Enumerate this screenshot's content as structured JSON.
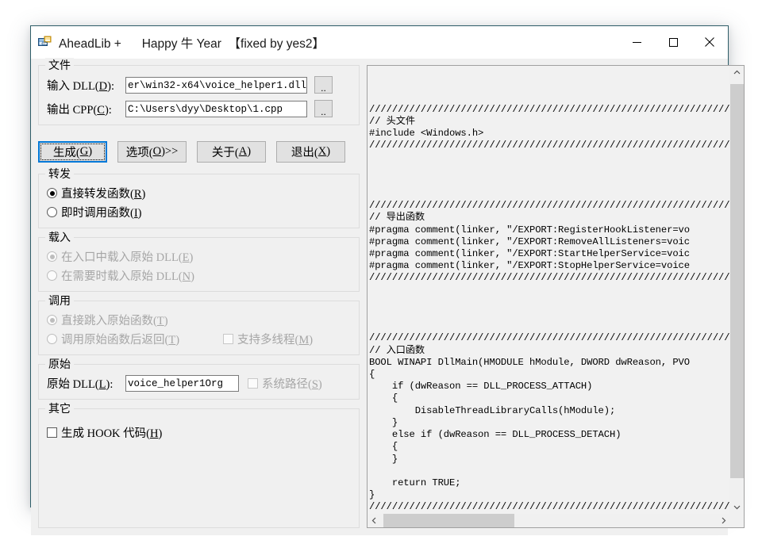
{
  "window": {
    "icon": "aheadlib-app-icon",
    "title": "AheadLib +      Happy 牛 Year  【fixed by yes2】",
    "controls": {
      "minimize": "minimize-icon",
      "maximize": "maximize-icon",
      "close": "close-icon"
    }
  },
  "file_group": {
    "title": "文件",
    "input_dll": {
      "label": "输入 DLL(D):",
      "label_plain": "输入 DLL(",
      "accel": "D",
      "label_tail": "):",
      "value": "er\\win32-x64\\voice_helper1.dll",
      "browse_label": ".."
    },
    "output_cpp": {
      "label_plain": "输出 CPP(",
      "accel": "C",
      "label_tail": "):",
      "value": "C:\\Users\\dyy\\Desktop\\1.cpp",
      "browse_label": ".."
    }
  },
  "actions": [
    {
      "name": "generate",
      "text_before": "生成(",
      "accel": "G",
      "text_after": ")",
      "focused": true
    },
    {
      "name": "options",
      "text_before": "选项(",
      "accel": "O",
      "text_after": ")>>",
      "focused": false
    },
    {
      "name": "about",
      "text_before": "关于(",
      "accel": "A",
      "text_after": ")",
      "focused": false
    },
    {
      "name": "exit",
      "text_before": "退出(",
      "accel": "X",
      "text_after": ")",
      "focused": false
    }
  ],
  "forward_group": {
    "title": "转发",
    "disabled": false,
    "options": [
      {
        "name": "direct-forward",
        "before": "直接转发函数(",
        "accel": "R",
        "after": ")",
        "checked": true
      },
      {
        "name": "immediate-call",
        "before": "即时调用函数(",
        "accel": "I",
        "after": ")",
        "checked": false
      }
    ]
  },
  "load_group": {
    "title": "载入",
    "disabled": true,
    "options": [
      {
        "name": "load-at-entry",
        "before": "在入口中载入原始 DLL(",
        "accel": "E",
        "after": ")",
        "checked": true
      },
      {
        "name": "load-on-demand",
        "before": "在需要时载入原始 DLL(",
        "accel": "N",
        "after": ")",
        "checked": false
      }
    ]
  },
  "call_group": {
    "title": "调用",
    "disabled": true,
    "options": [
      {
        "name": "jump-to-original",
        "before": "直接跳入原始函数(",
        "accel": "T",
        "after": ")",
        "checked": true
      },
      {
        "name": "call-then-return",
        "before": "调用原始函数后返回(",
        "accel": "T",
        "after": ")",
        "checked": false
      }
    ],
    "multithread": {
      "name": "support-multithread",
      "before": "支持多线程(",
      "accel": "M",
      "after": ")",
      "checked": false
    }
  },
  "original_group": {
    "title": "原始",
    "disabled": false,
    "dll_label_before": "原始 DLL(",
    "dll_label_accel": "L",
    "dll_label_after": "):",
    "dll_value": "voice_helper1Org",
    "syspath": {
      "name": "system-path",
      "before": "系统路径(",
      "accel": "S",
      "after": ")",
      "checked": false,
      "disabled": true
    }
  },
  "other_group": {
    "title": "其它",
    "hook_checkbox": {
      "name": "generate-hook-code",
      "before": "生成 HOOK 代码(",
      "accel": "H",
      "after": ")",
      "checked": false
    }
  },
  "code_preview": {
    "text": "\n\n\n///////////////////////////////////////////////////////////////\n// 头文件\n#include <Windows.h>\n///////////////////////////////////////////////////////////////\n\n\n\n\n///////////////////////////////////////////////////////////////\n// 导出函数\n#pragma comment(linker, \"/EXPORT:RegisterHookListener=vo\n#pragma comment(linker, \"/EXPORT:RemoveAllListeners=voic\n#pragma comment(linker, \"/EXPORT:StartHelperService=voic\n#pragma comment(linker, \"/EXPORT:StopHelperService=voice\n///////////////////////////////////////////////////////////////\n\n\n\n\n///////////////////////////////////////////////////////////////\n// 入口函数\nBOOL WINAPI DllMain(HMODULE hModule, DWORD dwReason, PVO\n{\n    if (dwReason == DLL_PROCESS_ATTACH)\n    {\n        DisableThreadLibraryCalls(hModule);\n    }\n    else if (dwReason == DLL_PROCESS_DETACH)\n    {\n    }\n\n    return TRUE;\n}\n///////////////////////////////////////////////////////////////",
    "scrollbar_vertical": {
      "up": "scroll-up-icon",
      "down": "scroll-down-icon"
    },
    "scrollbar_horizontal": {
      "left": "scroll-left-icon",
      "right": "scroll-right-icon"
    }
  },
  "colors": {
    "window_border": "#2e5d68",
    "dialog_bg": "#f0f0f0",
    "focus_blue": "#0078d7",
    "scroll_thumb": "#cdcdcd"
  }
}
